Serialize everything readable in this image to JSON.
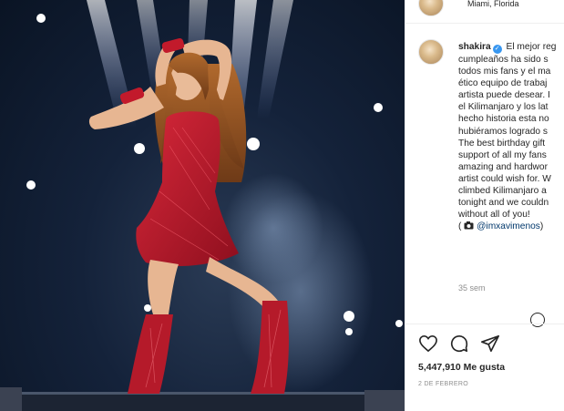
{
  "post": {
    "location": "Miami, Florida",
    "username": "shakira",
    "caption_lines": [
      "El mejor reg",
      "cumpleaños ha sido s",
      "todos mis fans y el ma",
      "ético equipo de trabaj",
      "artista puede desear. I",
      "el Kilimanjaro y los lat",
      "hecho historia esta no",
      "hubiéramos logrado s",
      "The best birthday gift",
      "support of all my fans",
      "amazing and hardwor",
      "artist could wish for. W",
      "climbed Kilimanjaro a",
      "tonight and we couldn",
      "without all of you!"
    ],
    "credit_mention": "@imxavimenos",
    "time_ago": "35 sem",
    "likes": "5,447,910 Me gusta",
    "date": "2 DE FEBRERO"
  },
  "icons": {
    "verified": "verified-badge-icon",
    "like": "heart-icon",
    "comment": "comment-icon",
    "share": "paper-plane-icon",
    "camera": "camera-icon",
    "more": "more-options-icon"
  },
  "colors": {
    "verified": "#3897f0",
    "mention": "#00376b",
    "secondary_text": "#8e8e8e",
    "dress": "#b51a2a"
  }
}
